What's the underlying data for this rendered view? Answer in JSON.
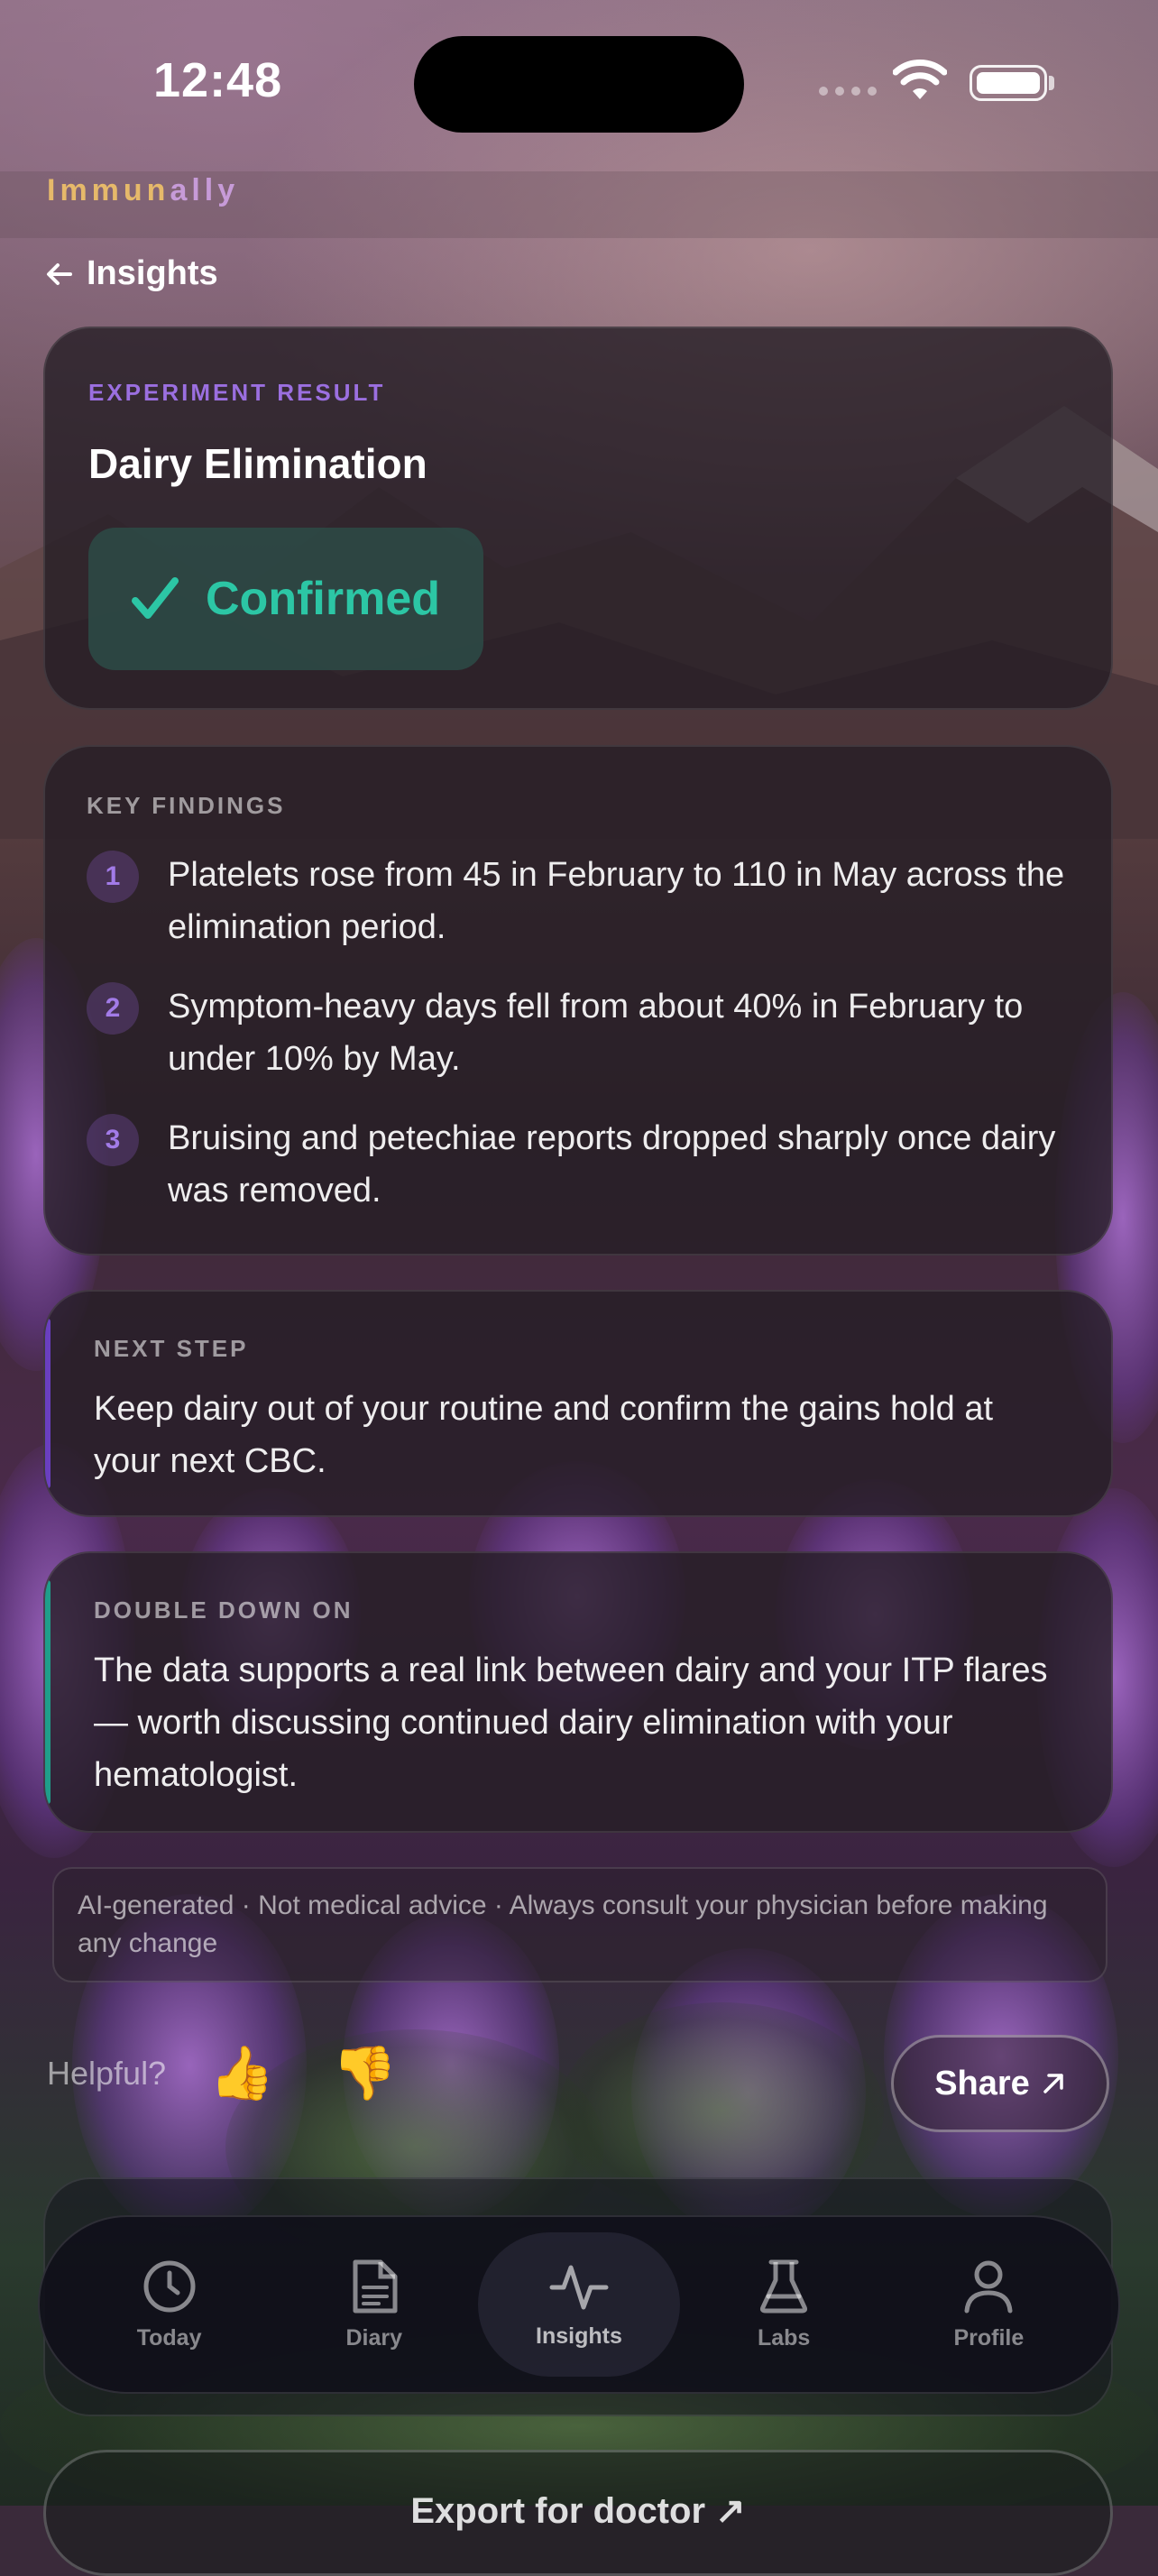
{
  "status_bar": {
    "time": "12:48"
  },
  "brand": {
    "part1": "Immun",
    "part2": "ally"
  },
  "nav": {
    "back_label": "Insights"
  },
  "result": {
    "eyebrow": "EXPERIMENT RESULT",
    "title": "Dairy Elimination",
    "status": "Confirmed"
  },
  "findings": {
    "eyebrow": "KEY FINDINGS",
    "items": [
      {
        "num": "1",
        "text": "Platelets rose from 45 in February to 110 in May across the elimination period."
      },
      {
        "num": "2",
        "text": "Symptom-heavy days fell from about 40% in February to under 10% by May."
      },
      {
        "num": "3",
        "text": "Bruising and petechiae reports dropped sharply once dairy was removed."
      }
    ]
  },
  "next_step": {
    "eyebrow": "NEXT STEP",
    "text": "Keep dairy out of your routine and confirm the gains hold at your next CBC."
  },
  "double_down": {
    "eyebrow": "DOUBLE DOWN ON",
    "text": "The data supports a real link between dairy and your ITP flares — worth discussing continued dairy elimination with your hematologist."
  },
  "disclaimer": "AI-generated · Not medical advice · Always consult your physician before making any change",
  "feedback": {
    "label": "Helpful?",
    "thumbs_up": "👍",
    "thumbs_down": "👎"
  },
  "share": {
    "label": "Share"
  },
  "tabs": [
    {
      "label": "Today",
      "icon": "clock-icon"
    },
    {
      "label": "Diary",
      "icon": "document-icon"
    },
    {
      "label": "Insights",
      "icon": "pulse-icon"
    },
    {
      "label": "Labs",
      "icon": "flask-icon"
    },
    {
      "label": "Profile",
      "icon": "person-icon"
    }
  ],
  "export": {
    "label": "Export for doctor ↗"
  },
  "colors": {
    "accent_purple": "#9b6fe0",
    "confirmed_teal": "#2cc6a5",
    "brand_gold": "#e6b96a",
    "brand_lilac": "#c79bd8"
  }
}
